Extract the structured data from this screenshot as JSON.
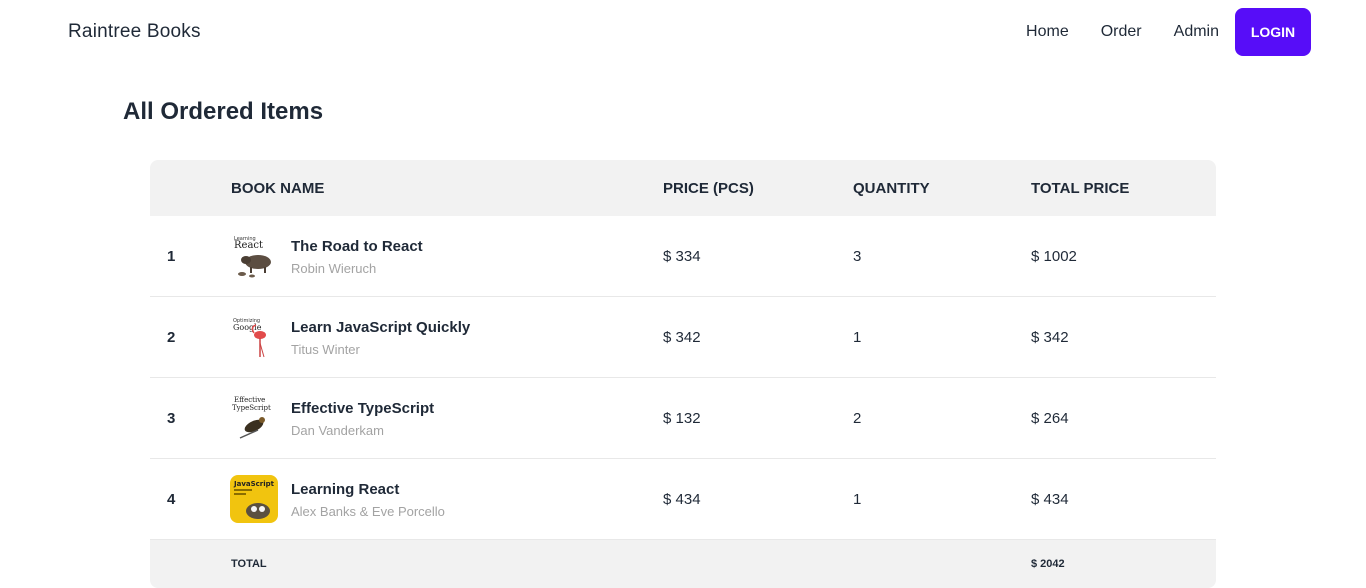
{
  "nav": {
    "brand": "Raintree Books",
    "links": [
      "Home",
      "Order",
      "Admin"
    ],
    "login": "LOGIN"
  },
  "page": {
    "title": "All Ordered Items"
  },
  "table": {
    "headers": [
      "BOOK NAME",
      "PRICE (PCS)",
      "QUANTITY",
      "TOTAL PRICE"
    ],
    "rows": [
      {
        "index": "1",
        "title": "The Road to React",
        "author": "Robin Wieruch",
        "price": "$ 334",
        "quantity": "3",
        "total": "$ 1002"
      },
      {
        "index": "2",
        "title": "Learn JavaScript Quickly",
        "author": "Titus Winter",
        "price": "$ 342",
        "quantity": "1",
        "total": "$ 342"
      },
      {
        "index": "3",
        "title": "Effective TypeScript",
        "author": "Dan Vanderkam",
        "price": "$ 132",
        "quantity": "2",
        "total": "$ 264"
      },
      {
        "index": "4",
        "title": "Learning React",
        "author": "Alex Banks & Eve Porcello",
        "price": "$ 434",
        "quantity": "1",
        "total": "$ 434"
      }
    ],
    "footer": {
      "label": "TOTAL",
      "total": "$ 2042"
    }
  },
  "covers": {
    "road_to_react": {
      "caption": "React",
      "subcaption": "Learning",
      "accent": "#6b5b4b"
    },
    "learn_js": {
      "caption": "Google",
      "subcaption": "Optimizing",
      "accent": "#e24b4b"
    },
    "effective_ts": {
      "caption": "TypeScript",
      "subcaption": "Effective",
      "accent": "#7a5a2a"
    },
    "learning_react": {
      "caption": "JavaScript",
      "subcaption": "",
      "accent": "#f1c40f"
    }
  },
  "colors": {
    "primary": "#570df8",
    "header_bg": "#f2f2f2",
    "muted": "#a3a3a3"
  }
}
